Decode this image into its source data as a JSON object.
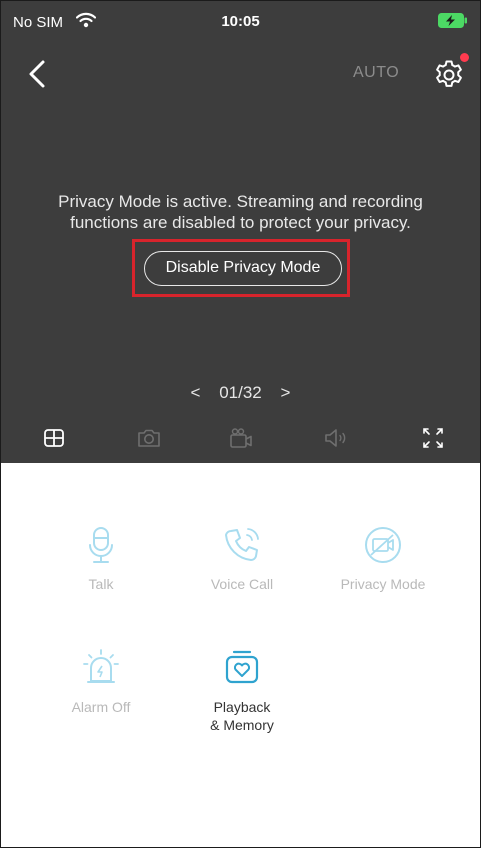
{
  "status_bar": {
    "carrier": "No SIM",
    "time": "10:05",
    "wifi_icon": "wifi-icon",
    "battery_icon": "battery-charging-icon"
  },
  "header": {
    "mode": "AUTO",
    "back_icon": "chevron-left-icon",
    "settings_icon": "gear-icon"
  },
  "privacy": {
    "message_line1": "Privacy Mode is active. Streaming and recording",
    "message_line2": "functions are disabled to protect your privacy.",
    "button_label": "Disable Privacy Mode"
  },
  "pager": {
    "prev": "<",
    "current": "01/32",
    "next": ">"
  },
  "toolbar": {
    "icons": [
      "grid-icon",
      "camera-icon",
      "video-record-icon",
      "speaker-icon",
      "fullscreen-icon"
    ]
  },
  "controls": {
    "talk": "Talk",
    "voice_call": "Voice Call",
    "privacy_mode": "Privacy Mode",
    "alarm_off": "Alarm Off",
    "playback_line1": "Playback",
    "playback_line2": "& Memory"
  },
  "colors": {
    "dark_bg": "#3d3d3d",
    "accent_light": "#a8dcef",
    "accent_active": "#2fa3cf",
    "highlight_red": "#d8242c",
    "notification_dot": "#ff3b4f"
  }
}
